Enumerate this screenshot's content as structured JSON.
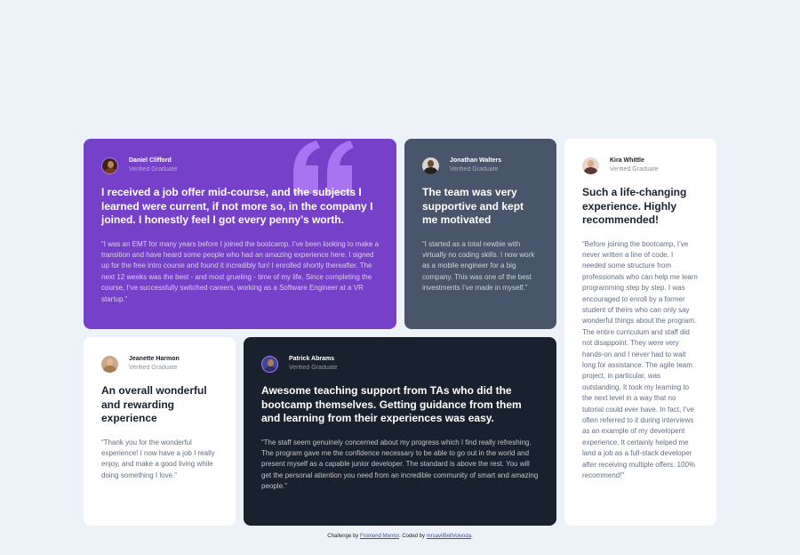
{
  "testimonials": [
    {
      "name": "Daniel Clifford",
      "role": "Verified Graduate",
      "headline": "I received a job offer mid-course, and the subjects I learned were current, if not more so, in the company I joined. I honestly feel I got every penny’s worth.",
      "body": "“I was an EMT for many years before I joined the bootcamp. I’ve been looking to make a transition and have heard some people who had an amazing experience here. I signed up for the free intro course and found it incredibly fun! I enrolled shortly thereafter. The next 12 weeks was the best - and most grueling - time of my life. Since completing the course, I’ve successfully switched careers, working as a Software Engineer at a VR startup.”",
      "accent": "#7541c8"
    },
    {
      "name": "Jonathan Walters",
      "role": "Verified Graduate",
      "headline": "The team was very supportive and kept me motivated",
      "body": "“I started as a total newbie with virtually no coding skills. I now work as a mobile engineer for a big company. This was one of the best investments I’ve made in myself.”",
      "accent": "#48556a"
    },
    {
      "name": "Jeanette Harmon",
      "role": "Verified Graduate",
      "headline": "An overall wonderful and rewarding experience",
      "body": "“Thank you for the wonderful experience! I now have a job I really enjoy, and make a good living while doing something I love.”",
      "accent": "#ffffff"
    },
    {
      "name": "Patrick Abrams",
      "role": "Verified Graduate",
      "headline": "Awesome teaching support from TAs who did the bootcamp themselves. Getting guidance from them and learning from their experiences was easy.",
      "body": "“The staff seem genuinely concerned about my progress which I find really refreshing. The program gave me the confidence necessary to be able to go out in the world and present myself as a capable junior developer. The standard is above the rest. You will get the personal attention you need from an incredible community of smart and amazing people.”",
      "accent": "#19212e"
    },
    {
      "name": "Kira Whittle",
      "role": "Verified Graduate",
      "headline": "Such a life-changing experience. Highly recommended!",
      "body": "“Before joining the bootcamp, I’ve never written a line of code. I needed some structure from professionals who can help me learn programming step by step. I was encouraged to enroll by a former student of theirs who can only say wonderful things about the program. The entire curriculum and staff did not disappoint. They were very hands-on and I never had to wait long for assistance. The agile team project, in particular, was outstanding. It took my learning to the next level in a way that no tutorial could ever have. In fact, I’ve often referred to it during interviews as an example of my developent experience. It certainly helped me land a job as a full-stack developer after receiving multiple offers. 100% recommend!”",
      "accent": "#ffffff"
    }
  ],
  "footer": {
    "prefix": "Challenge by",
    "link1": "Frontend Mentor",
    "middle": ". Coded by",
    "link2": "mrsavilBellVoivoda",
    "suffix": "."
  },
  "icons": {
    "quote": "quotation-mark-icon",
    "avatar": "avatar-photo"
  }
}
